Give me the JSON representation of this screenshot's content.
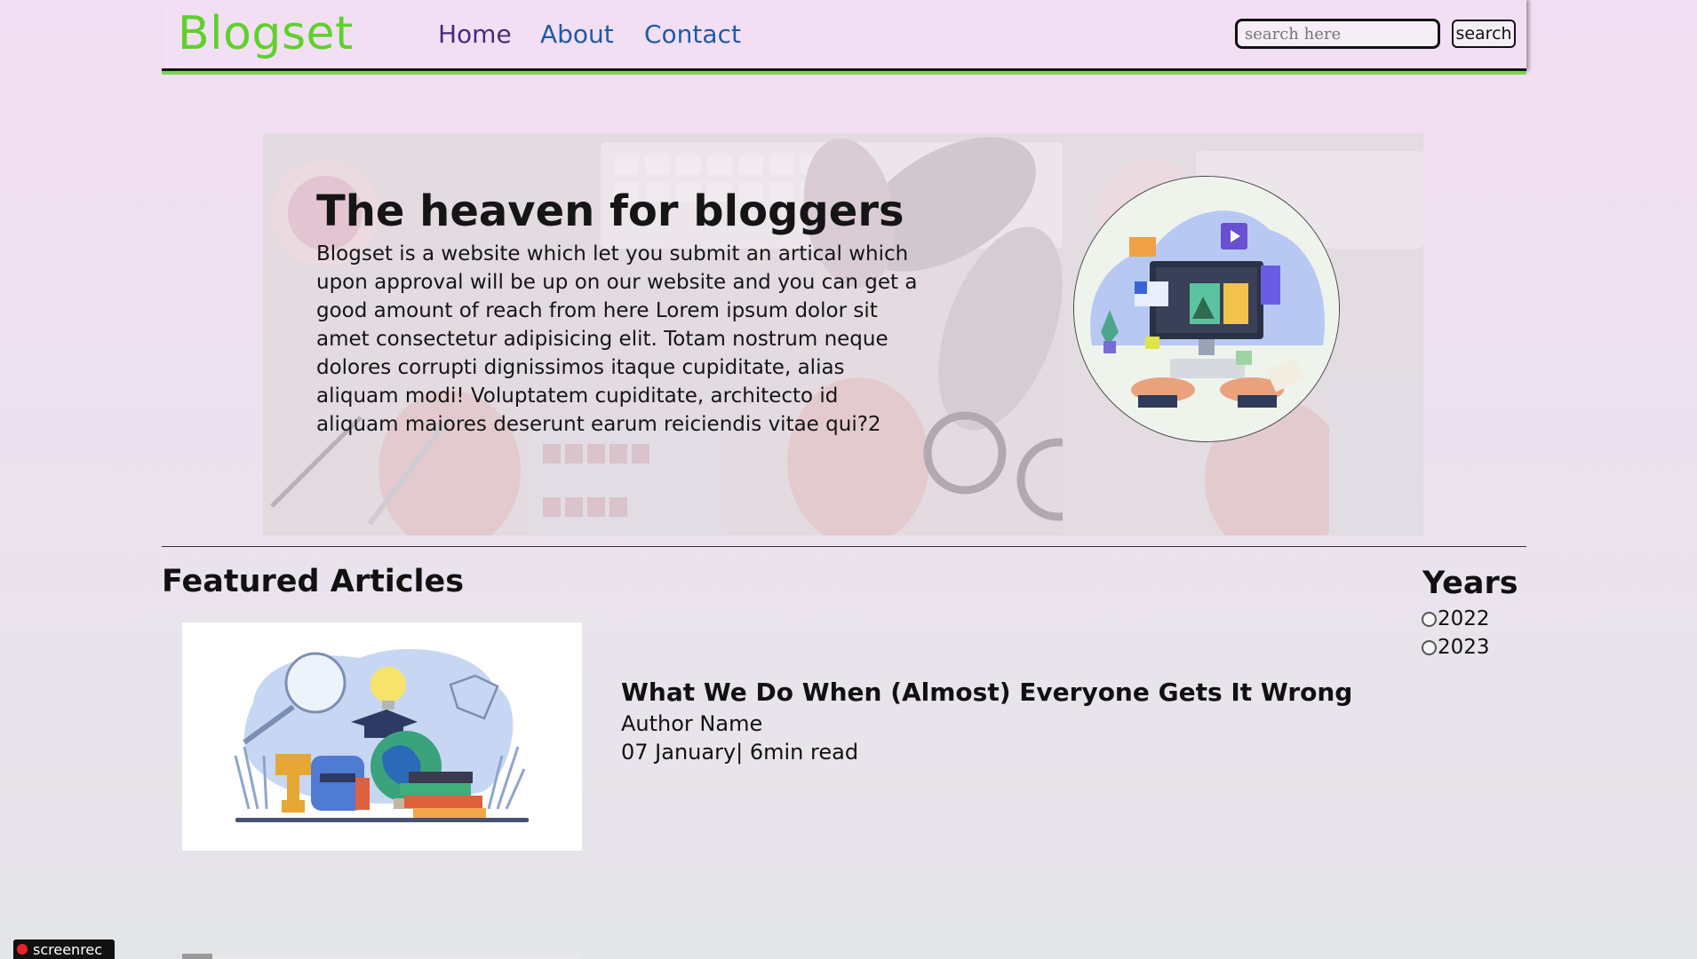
{
  "header": {
    "logo": "Blogset",
    "nav": [
      {
        "label": "Home"
      },
      {
        "label": "About"
      },
      {
        "label": "Contact"
      }
    ],
    "search": {
      "placeholder": "search here",
      "button_label": "search"
    }
  },
  "hero": {
    "title": "The heaven for bloggers",
    "text": "Blogset is a website which let you submit an artical which upon approval will be up on our website and you can get a good amount of reach from here Lorem ipsum dolor sit amet consectetur adipisicing elit. Totam nostrum neque dolores corrupti dignissimos itaque cupiditate, alias aliquam modi! Voluptatem cupiditate, architecto id aliquam maiores deserunt earum reiciendis vitae qui?2"
  },
  "featured": {
    "heading": "Featured Articles",
    "articles": [
      {
        "title": "What We Do When (Almost) Everyone Gets It Wrong",
        "author": "Author Name",
        "meta": "07 January| 6min read"
      }
    ]
  },
  "years": {
    "heading": "Years",
    "options": [
      {
        "label": "2022",
        "selected": false
      },
      {
        "label": "2023",
        "selected": false
      }
    ]
  },
  "recorder": {
    "label": "screenrec"
  },
  "colors": {
    "logo": "#5ed12b",
    "nav_active": "#4b2a78",
    "nav_link": "#1f5aa8",
    "header_underline": "#7ad44f"
  }
}
